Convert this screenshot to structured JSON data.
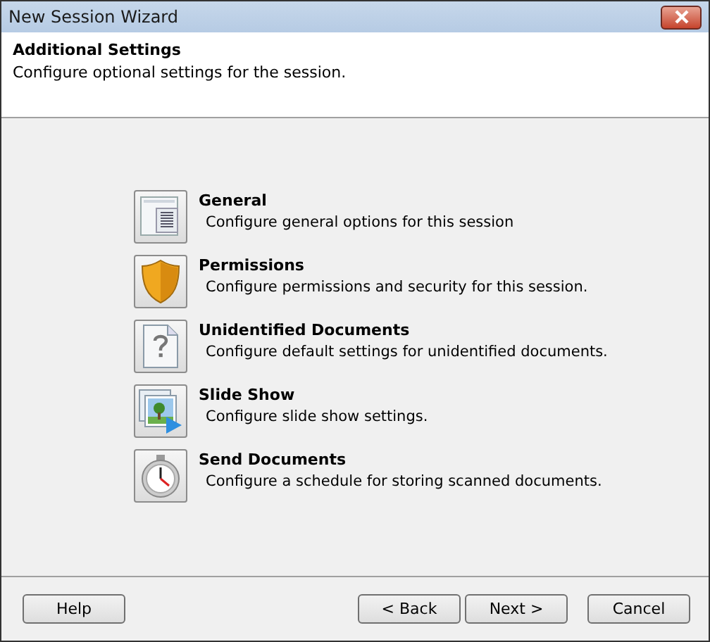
{
  "window": {
    "title": "New Session Wizard"
  },
  "header": {
    "title": "Additional Settings",
    "subtitle": "Configure optional settings for the session."
  },
  "options": [
    {
      "kind": "general",
      "title": "General",
      "description": "Configure general options for this session"
    },
    {
      "kind": "permissions",
      "title": "Permissions",
      "description": "Configure permissions and security for this session."
    },
    {
      "kind": "unidentified",
      "title": "Unidentified Documents",
      "description": "Configure default settings for unidentified documents."
    },
    {
      "kind": "slideshow",
      "title": "Slide Show",
      "description": "Configure slide show settings."
    },
    {
      "kind": "send",
      "title": "Send Documents",
      "description": "Configure a schedule for storing scanned documents."
    }
  ],
  "buttons": {
    "help": "Help",
    "back": "< Back",
    "next": "Next >",
    "cancel": "Cancel"
  }
}
